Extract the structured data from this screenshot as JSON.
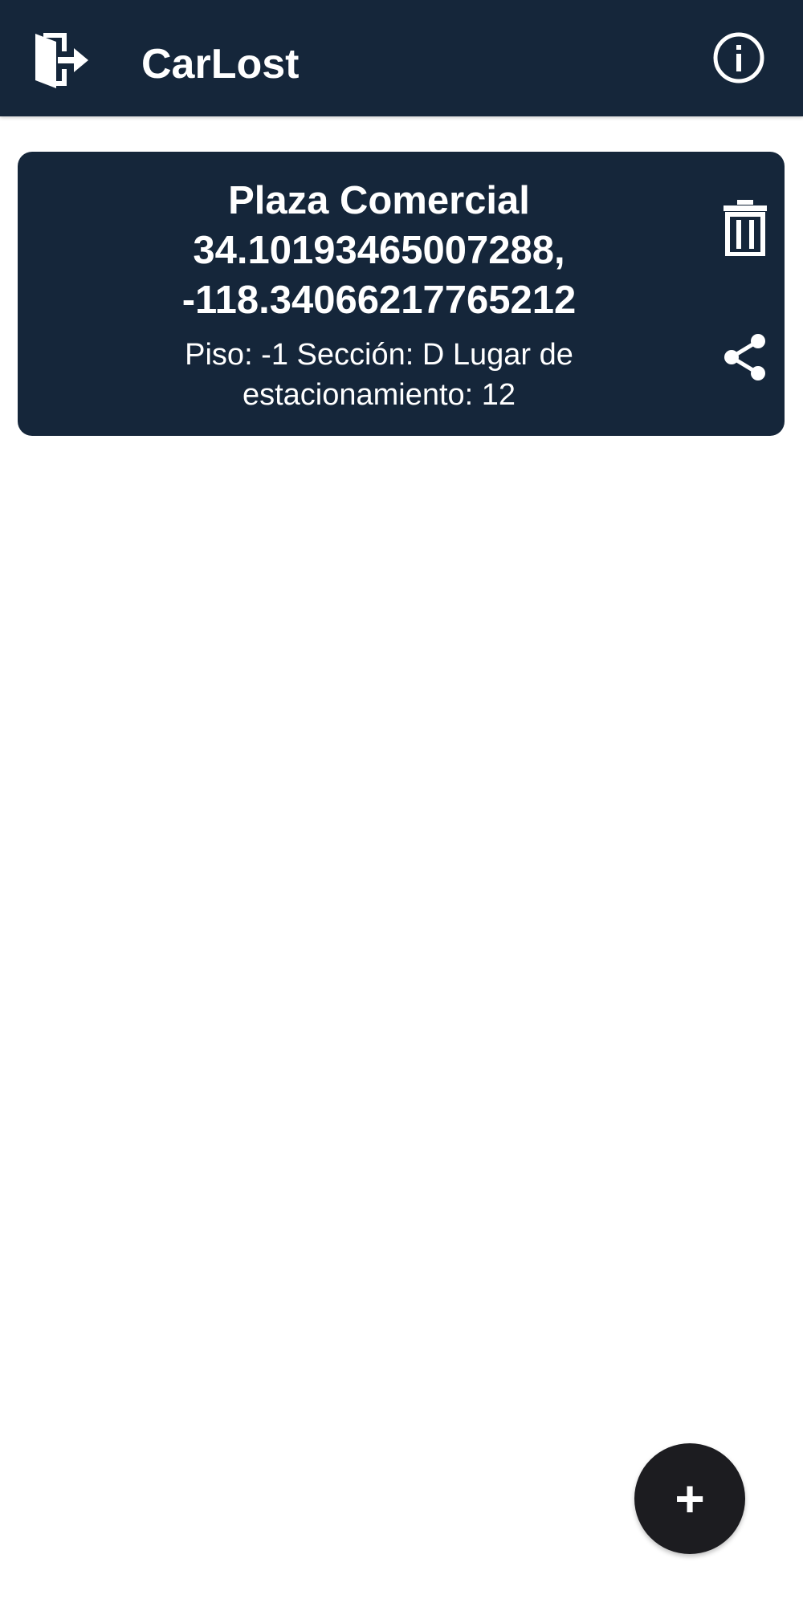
{
  "app_bar": {
    "title": "CarLost",
    "logout_icon": "logout-door-icon",
    "info_icon": "info-circle-icon"
  },
  "parking_entries": [
    {
      "name": "Plaza Comercial",
      "coordinates": "34.10193465007288,\n-118.34066217765212",
      "details": "Piso: -1 Sección: D Lugar de estacionamiento: 12",
      "delete_icon": "trash-icon",
      "share_icon": "share-icon"
    }
  ],
  "fab": {
    "glyph": "+",
    "icon": "plus-icon"
  },
  "colors": {
    "primary": "#15263a",
    "fab": "#1c1c20",
    "on_primary": "#ffffff",
    "background": "#ffffff"
  }
}
